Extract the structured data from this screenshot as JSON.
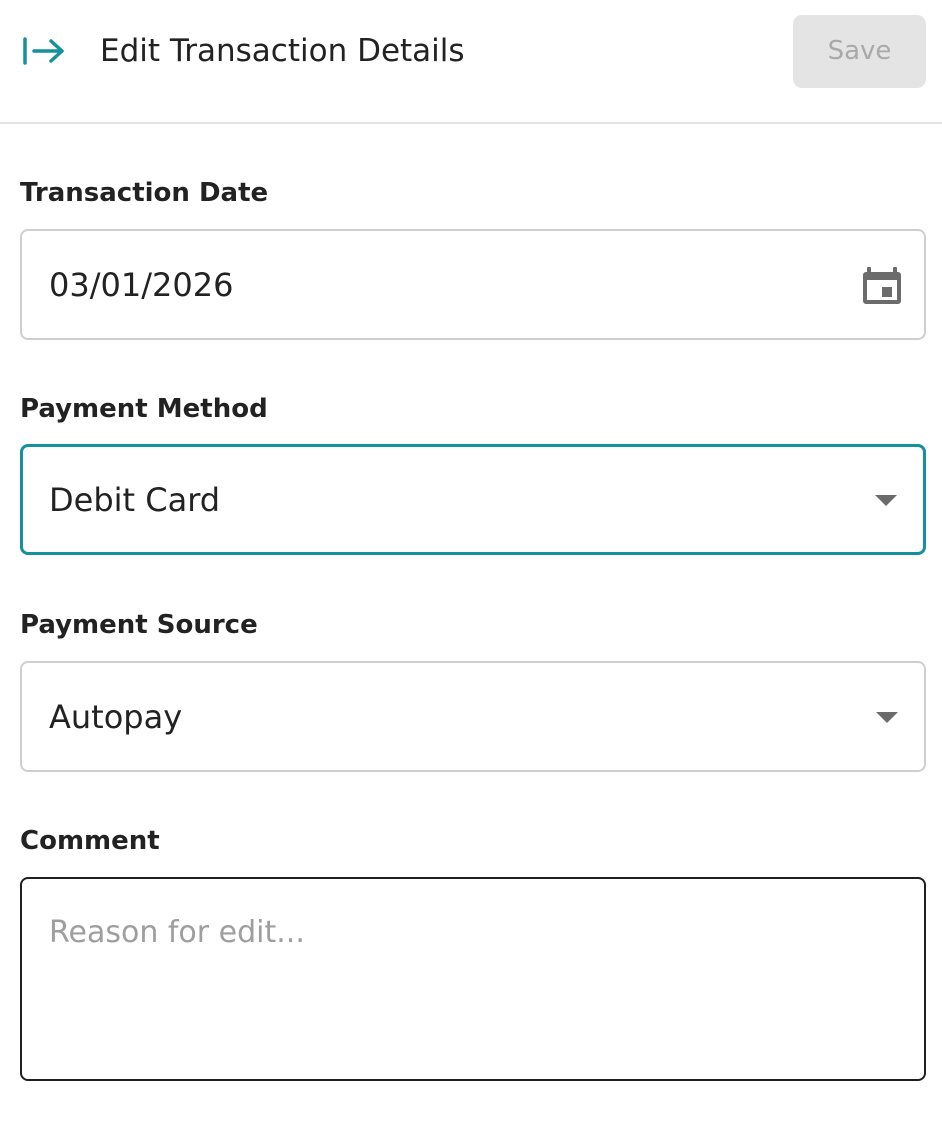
{
  "header": {
    "title": "Edit Transaction Details",
    "save_label": "Save",
    "collapse_icon": "arrow-right-to-bar-icon",
    "accent_color": "#14919b"
  },
  "form": {
    "transaction_date": {
      "label": "Transaction Date",
      "value": "03/01/2026",
      "icon": "calendar-icon"
    },
    "payment_method": {
      "label": "Payment Method",
      "value": "Debit Card",
      "focused": true,
      "icon": "caret-down-icon"
    },
    "payment_source": {
      "label": "Payment Source",
      "value": "Autopay",
      "icon": "caret-down-icon"
    },
    "comment": {
      "label": "Comment",
      "value": "",
      "placeholder": "Reason for edit..."
    }
  }
}
